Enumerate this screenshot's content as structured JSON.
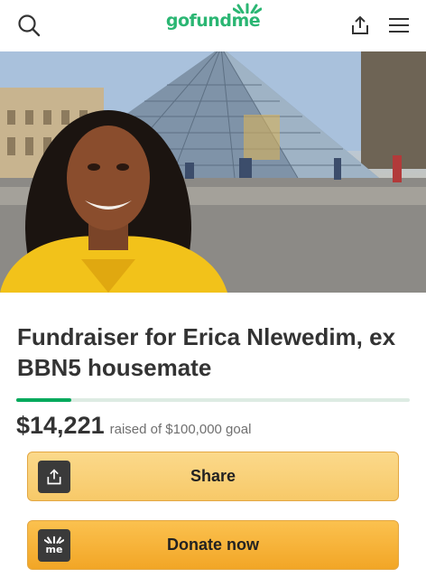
{
  "header": {
    "logo_text_a": "gofund",
    "logo_text_b": "me",
    "icons": [
      "search-icon",
      "share-upload-icon",
      "hamburger-menu-icon"
    ]
  },
  "hero": {
    "image_subject": "photo"
  },
  "campaign": {
    "title": "Fundraiser for Erica Nlewedim, ex BBN5 housemate",
    "raised": "$14,221",
    "goal_text": "raised of $100,000 goal",
    "progress_fraction": 0.14
  },
  "actions": {
    "share_label": "Share",
    "donate_label": "Donate now",
    "donate_icon_text": "me"
  },
  "colors": {
    "brand_green": "#02a95c",
    "share_button": "#f9d27a",
    "donate_button": "#f6b13a"
  }
}
